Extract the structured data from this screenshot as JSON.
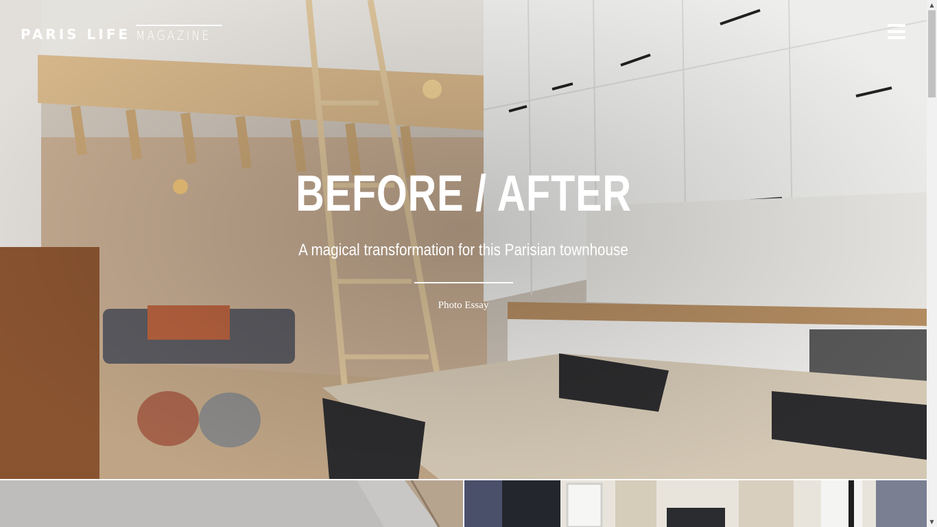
{
  "header": {
    "logo_primary": "PARIS LIFE",
    "logo_secondary": "MAGAZINE",
    "menu_icon": "hamburger-menu-icon"
  },
  "hero": {
    "title": "BEFORE / AFTER",
    "subtitle": "A magical transformation for this Parisian townhouse",
    "category": "Photo Essay",
    "image": "loft-kitchen-living-room-photo"
  },
  "tiles": [
    {
      "image": "white-room-interior-photo"
    },
    {
      "image": "townhouse-facade-with-wisteria-photo"
    }
  ],
  "scrollbar": {
    "up_icon": "▲",
    "down_icon": "▼"
  },
  "colors": {
    "text": "#ffffff",
    "scrollbar_track": "#f1f1f1",
    "scrollbar_thumb": "#c1c1c1"
  }
}
